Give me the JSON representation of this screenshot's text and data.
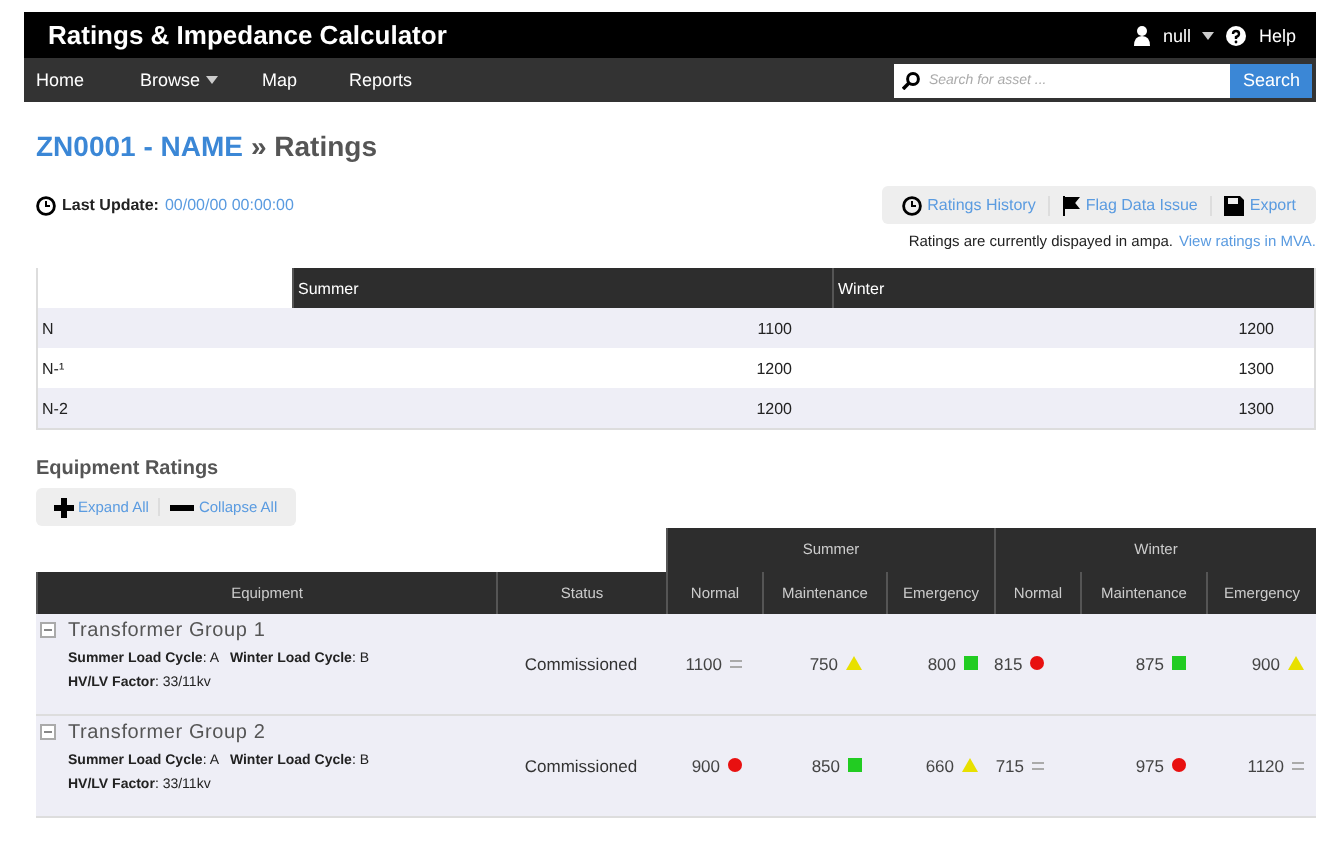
{
  "header": {
    "title": "Ratings & Impedance Calculator",
    "user": "null",
    "help": "Help"
  },
  "nav": {
    "items": [
      {
        "label": "Home",
        "has_menu": false
      },
      {
        "label": "Browse",
        "has_menu": true
      },
      {
        "label": "Map",
        "has_menu": false
      },
      {
        "label": "Reports",
        "has_menu": false
      }
    ],
    "search": {
      "placeholder": "Search for asset ...",
      "button": "Search"
    }
  },
  "breadcrumb": {
    "link": "ZN0001 - NAME",
    "current": "» Ratings"
  },
  "last_update": {
    "label": "Last Update:",
    "value": "00/00/00 00:00:00"
  },
  "actions": [
    {
      "label": "Ratings History",
      "kind": "history"
    },
    {
      "label": "Flag Data Issue",
      "kind": "flag"
    },
    {
      "label": "Export",
      "kind": "save"
    }
  ],
  "units_note": {
    "text": "Ratings are currently dispayed in ampa.",
    "link": "View ratings in MVA."
  },
  "summary_table": {
    "columns": [
      "Summer",
      "Winter"
    ],
    "rows": [
      {
        "label": "N",
        "values": [
          "1100",
          "1200"
        ]
      },
      {
        "label": "N-¹",
        "values": [
          "1200",
          "1300"
        ]
      },
      {
        "label": "N-2",
        "values": [
          "1200",
          "1300"
        ]
      }
    ]
  },
  "equipment": {
    "title": "Equipment Ratings",
    "toggles": [
      {
        "label": "Expand All",
        "kind": "expand"
      },
      {
        "label": "Collapse All",
        "kind": "collapse"
      }
    ],
    "column_groups": [
      "Summer",
      "Winter"
    ],
    "columns": [
      "Equipment",
      "Status",
      "Normal",
      "Maintenance",
      "Emergency",
      "Normal",
      "Maintenance",
      "Emergency"
    ],
    "rows": [
      {
        "name": "Transformer Group 1",
        "expanded": true,
        "details": [
          "**Summer Load Cycle**: A   **Winter Load Cycle**: B",
          "**HV/LV Factor**: 33/11kv"
        ],
        "status": "Commissioned",
        "ratings": [
          {
            "value": "1100",
            "kind": "equal"
          },
          {
            "value": "750",
            "kind": "triangle"
          },
          {
            "value": "800",
            "kind": "square"
          },
          {
            "value": "815",
            "kind": "dot"
          },
          {
            "value": "875",
            "kind": "square"
          },
          {
            "value": "900",
            "kind": "triangle"
          }
        ]
      },
      {
        "name": "Transformer Group 2",
        "expanded": true,
        "details": [
          "**Summer Load Cycle**: A   **Winter Load Cycle**: B",
          "**HV/LV Factor**: 33/11kv"
        ],
        "status": "Commissioned",
        "ratings": [
          {
            "value": "900",
            "kind": "dot"
          },
          {
            "value": "850",
            "kind": "square"
          },
          {
            "value": "660",
            "kind": "triangle"
          },
          {
            "value": "715",
            "kind": "equal"
          },
          {
            "value": "975",
            "kind": "dot"
          },
          {
            "value": "1120",
            "kind": "equal"
          }
        ]
      }
    ]
  }
}
